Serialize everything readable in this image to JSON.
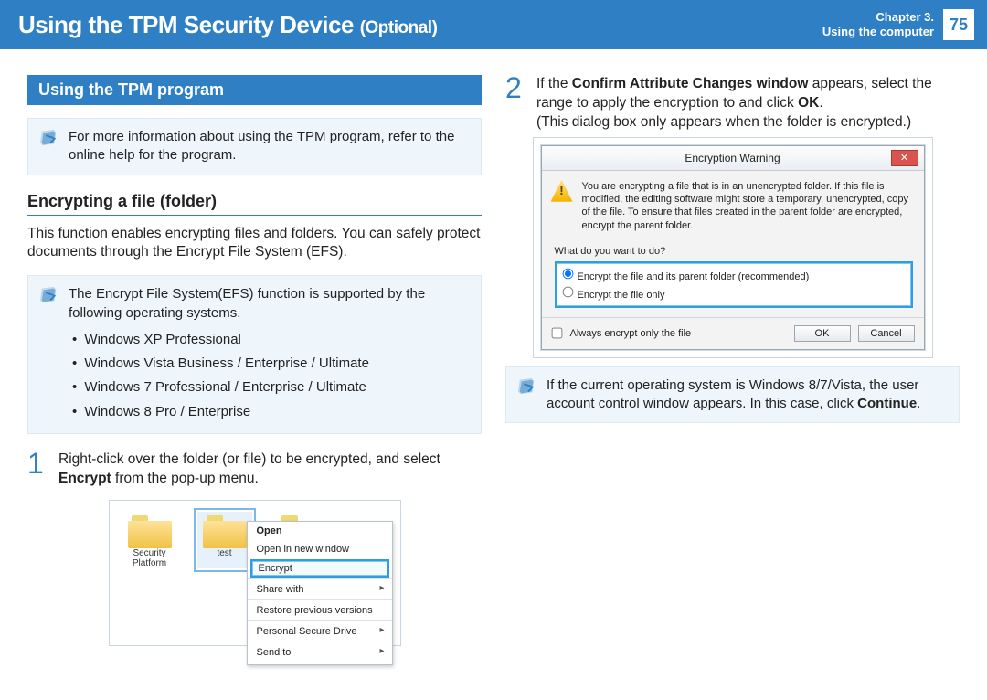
{
  "chapter": {
    "line1": "Chapter 3.",
    "line2": "Using the computer",
    "page": "75"
  },
  "title": {
    "main": "Using the TPM Security Device",
    "suffix": "(Optional)"
  },
  "section_bar": "Using the TPM program",
  "note1": "For more information about using the TPM program, refer to the online help for the program.",
  "sub1": "Encrypting a file (folder)",
  "sub1_body": "This function enables encrypting files and folders. You can safely protect documents through the Encrypt File System (EFS).",
  "note2_intro": "The Encrypt File System(EFS) function is supported by the following operating systems.",
  "oslist": [
    "Windows XP Professional",
    "Windows Vista Business / Enterprise / Ultimate",
    "Windows 7 Professional / Enterprise / Ultimate",
    "Windows 8 Pro / Enterprise"
  ],
  "step1": {
    "num": "1",
    "pre": "Right-click over the folder (or file) to be encrypted, and select ",
    "bold": "Encrypt",
    "post": " from the pop-up menu."
  },
  "folders": {
    "a": "Security Platform",
    "b": "test"
  },
  "ctx": {
    "open": "Open",
    "new_window": "Open in new window",
    "encrypt": "Encrypt",
    "share": "Share with",
    "restore": "Restore previous versions",
    "psd": "Personal Secure Drive",
    "sendto": "Send to"
  },
  "step2": {
    "num": "2",
    "l1a": "If the ",
    "l1b": "Confirm Attribute Changes window",
    "l1c": " appears, select the range to apply the encryption to and click ",
    "l1d": "OK",
    "l1e": ".",
    "l2": "(This dialog box only appears when the folder is encrypted.)"
  },
  "dlg": {
    "title": "Encryption Warning",
    "body": "You are encrypting a file that is in an unencrypted folder. If this file is modified, the editing software might store a temporary, unencrypted, copy of the file. To ensure that files created in the parent folder are encrypted, encrypt the parent folder.",
    "q": "What do you want to do?",
    "r1": "Encrypt the file and its parent folder (recommended)",
    "r2": "Encrypt the file only",
    "always": "Always encrypt only the file",
    "ok": "OK",
    "cancel": "Cancel"
  },
  "note3": {
    "pre": "If the current operating system is Windows 8/7/Vista, the user account control window appears. In this case, click ",
    "bold": "Continue",
    "post": "."
  }
}
